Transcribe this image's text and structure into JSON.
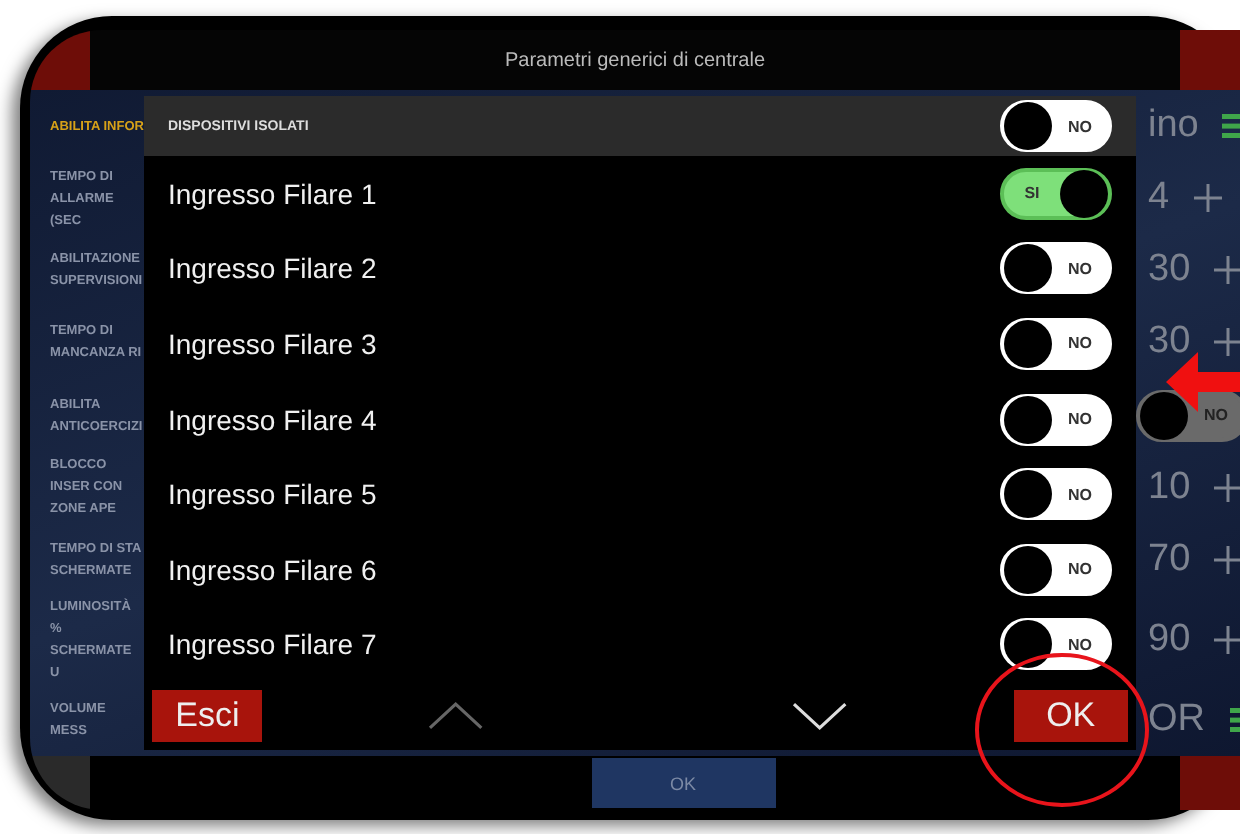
{
  "header": {
    "title": "Parametri generici di centrale"
  },
  "settings": [
    {
      "label": "ABILITA INFOR",
      "kind": "select",
      "value": "ino",
      "selected": true
    },
    {
      "label": "TEMPO DI ALLARME (SEC",
      "kind": "number",
      "value": "4",
      "selected": false
    },
    {
      "label": "ABILITAZIONE SUPERVISIONI",
      "kind": "number",
      "value": "30",
      "selected": false
    },
    {
      "label": "TEMPO DI MANCANZA RI",
      "kind": "number",
      "value": "30",
      "selected": false
    },
    {
      "label": "ABILITA ANTICOERCIZI",
      "kind": "toggle",
      "value": "NO",
      "on": false,
      "selected": false
    },
    {
      "label": "BLOCCO INSER CON ZONE APE",
      "kind": "number",
      "value": "10",
      "selected": false
    },
    {
      "label": "TEMPO DI STA SCHERMATE",
      "kind": "number",
      "value": "70",
      "selected": false
    },
    {
      "label": "LUMINOSITÀ % SCHERMATE U",
      "kind": "number",
      "value": "90",
      "selected": false
    },
    {
      "label": "VOLUME MESS",
      "kind": "select",
      "value": "OR",
      "selected": false
    }
  ],
  "dialog": {
    "title": "DISPOSITIVI ISOLATI",
    "title_toggle": {
      "on": false,
      "label": "NO"
    },
    "items": [
      {
        "label": "Ingresso Filare 1",
        "on": true,
        "toggle_label": "SI"
      },
      {
        "label": "Ingresso Filare 2",
        "on": false,
        "toggle_label": "NO"
      },
      {
        "label": "Ingresso Filare 3",
        "on": false,
        "toggle_label": "NO"
      },
      {
        "label": "Ingresso Filare 4",
        "on": false,
        "toggle_label": "NO"
      },
      {
        "label": "Ingresso Filare 5",
        "on": false,
        "toggle_label": "NO"
      },
      {
        "label": "Ingresso Filare 6",
        "on": false,
        "toggle_label": "NO"
      },
      {
        "label": "Ingresso Filare 7",
        "on": false,
        "toggle_label": "NO"
      }
    ],
    "cancel": "Esci",
    "confirm": "OK"
  },
  "footer": {
    "button": "OK"
  }
}
